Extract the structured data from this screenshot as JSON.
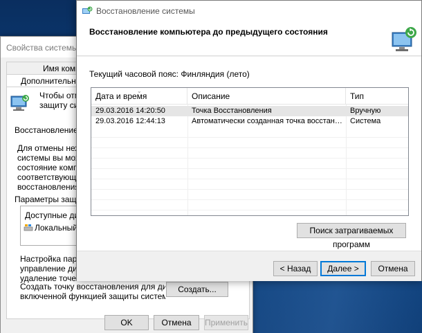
{
  "background_window": {
    "title": "Свойства системы",
    "tabs": [
      "Имя компь",
      "Дополнительно"
    ],
    "intro_text_lines": [
      "Чтобы отме",
      "защиту сист"
    ],
    "restore_label": "Восстановление сис",
    "restore_desc_lines": [
      "Для отмены нежел",
      "системы вы можете",
      "состояние компьют",
      "соответствующее п",
      "восстановления."
    ],
    "protection_label": "Параметры защиты",
    "available_disks_header": "Доступные диск",
    "disk_item": "Локальный д",
    "config_text_lines": [
      "Настройка параме",
      "управление диско",
      "удаление точек во"
    ],
    "create_text_lines": [
      "Создать точку восстановления для дисков с",
      "включенной функцией защиты системы."
    ],
    "create_button": "Создать...",
    "ok_button": "OK",
    "cancel_button": "Отмена",
    "apply_button": "Применить"
  },
  "restore_window": {
    "title": "Восстановление системы",
    "header_title": "Восстановление компьютера до предыдущего состояния",
    "timezone": "Текущий часовой пояс: Финляндия (лето)",
    "columns": [
      "Дата и время",
      "Описание",
      "Тип"
    ],
    "rows": [
      {
        "date": "29.03.2016 14:20:50",
        "description": "Точка Восстановления",
        "type": "Вручную"
      },
      {
        "date": "29.03.2016 12:44:13",
        "description": "Автоматически созданная точка восстановле...",
        "type": "Система"
      }
    ],
    "scan_button": "Поиск затрагиваемых программ",
    "back_button": "< Назад",
    "next_button": "Далее >",
    "cancel_button": "Отмена"
  },
  "colors": {
    "accent": "#0078d7",
    "selected_row": "#e5e5e5",
    "desktop": "#0f3d78"
  }
}
